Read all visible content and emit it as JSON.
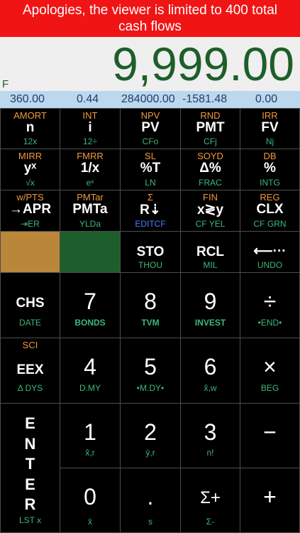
{
  "banner": {
    "line1": "Apologies, the viewer is limited to 400 total",
    "line2": "cash flows"
  },
  "display": {
    "value": "9,999.00",
    "flag": "F"
  },
  "registers": [
    "360.00",
    "0.44",
    "284000.00",
    "-1581.48",
    "0.00"
  ],
  "row1": [
    {
      "top": "AMORT",
      "main": "n",
      "bot": "12x"
    },
    {
      "top": "INT",
      "main": "i",
      "bot": "12÷"
    },
    {
      "top": "NPV",
      "main": "PV",
      "bot": "CFo"
    },
    {
      "top": "RND",
      "main": "PMT",
      "bot": "CFj"
    },
    {
      "top": "IRR",
      "main": "FV",
      "bot": "Nj"
    }
  ],
  "row2": [
    {
      "top": "MIRR",
      "main": "yˣ",
      "bot": "√x"
    },
    {
      "top": "FMRR",
      "main": "1/x",
      "bot": "eˣ"
    },
    {
      "top": "SL",
      "main": "%T",
      "bot": "LN"
    },
    {
      "top": "SOYD",
      "main": "Δ%",
      "bot": "FRAC"
    },
    {
      "top": "DB",
      "main": "%",
      "bot": "INTG"
    }
  ],
  "row3": [
    {
      "top": "w/PTS",
      "main": "→APR",
      "bot": "⇥ER"
    },
    {
      "top": "PMTar",
      "main": "PMTa",
      "bot": "YLDa"
    },
    {
      "top": "Σ",
      "main": "R⇣",
      "bot": "EDITCF"
    },
    {
      "top": "FIN",
      "main": "x≷y",
      "bot": "CF YEL"
    },
    {
      "top": "REG",
      "main": "CLX",
      "bot": "CF GRN"
    }
  ],
  "row4": [
    {
      "top": "",
      "main": "",
      "bot": ""
    },
    {
      "top": "",
      "main": "",
      "bot": ""
    },
    {
      "top": "",
      "main": "STO",
      "bot": "THOU"
    },
    {
      "top": "",
      "main": "RCL",
      "bot": "MIL"
    },
    {
      "top": "",
      "main": "⟵···",
      "bot": "UNDO"
    }
  ],
  "row5": [
    {
      "top": "",
      "main": "CHS",
      "bot": "DATE"
    },
    {
      "top": "",
      "main": "7",
      "bot": "BONDS"
    },
    {
      "top": "",
      "main": "8",
      "bot": "TVM"
    },
    {
      "top": "",
      "main": "9",
      "bot": "INVEST"
    },
    {
      "top": "",
      "main": "÷",
      "bot": "•END•"
    }
  ],
  "row6": [
    {
      "top": "SCI",
      "main": "EEX",
      "bot": "Δ DYS"
    },
    {
      "top": "",
      "main": "4",
      "bot": "D.MY"
    },
    {
      "top": "",
      "main": "5",
      "bot": "•M.DY•"
    },
    {
      "top": "",
      "main": "6",
      "bot": "x̂,w"
    },
    {
      "top": "",
      "main": "×",
      "bot": "BEG"
    }
  ],
  "row7": [
    {
      "top": "",
      "main": "1",
      "bot": "x̂,r"
    },
    {
      "top": "",
      "main": "2",
      "bot": "ŷ,r"
    },
    {
      "top": "",
      "main": "3",
      "bot": "n!"
    },
    {
      "top": "",
      "main": "−",
      "bot": ""
    }
  ],
  "row8": [
    {
      "top": "",
      "main": "0",
      "bot": "x̄"
    },
    {
      "top": "",
      "main": ".",
      "bot": "s"
    },
    {
      "top": "",
      "main": "Σ+",
      "bot": "Σ-"
    },
    {
      "top": "",
      "main": "+",
      "bot": ""
    }
  ],
  "enter": {
    "letters": [
      "E",
      "N",
      "T",
      "E",
      "R"
    ],
    "bot": "LST x"
  },
  "colors": {
    "banner": "#f01414",
    "display_text": "#1e5e2a",
    "register_bg": "#bcd8ef",
    "swatch_orange": "#b9863a",
    "swatch_green": "#1d5e2c",
    "shift_orange": "#f09a3a",
    "shift_green": "#3cb87a",
    "shift_blue": "#4a7fff"
  }
}
